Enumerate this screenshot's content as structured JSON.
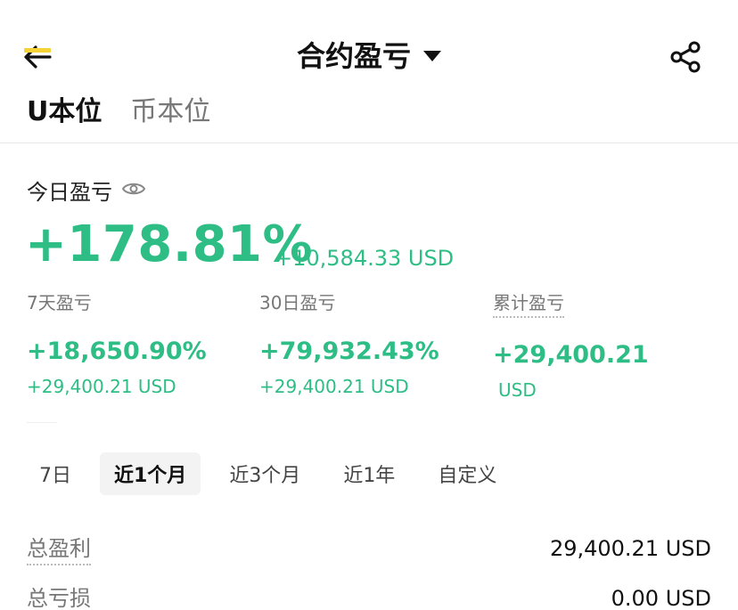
{
  "header": {
    "title": "合约盈亏",
    "back_icon": "arrow-left-icon",
    "share_icon": "share-icon"
  },
  "tabs": [
    {
      "label": "U本位",
      "active": true
    },
    {
      "label": "币本位",
      "active": false
    }
  ],
  "today": {
    "label": "今日盈亏",
    "percent": "+178.81%",
    "usd": "+10,584.33 USD"
  },
  "stats": [
    {
      "label": "7天盈亏",
      "percent": "+18,650.90%",
      "usd": "+29,400.21 USD"
    },
    {
      "label": "30日盈亏",
      "percent": "+79,932.43%",
      "usd": "+29,400.21 USD"
    },
    {
      "label": "累计盈亏",
      "percent": "+29,400.21",
      "usd": "USD"
    }
  ],
  "periods": [
    {
      "label": "7日",
      "selected": false
    },
    {
      "label": "近1个月",
      "selected": true
    },
    {
      "label": "近3个月",
      "selected": false
    },
    {
      "label": "近1年",
      "selected": false
    },
    {
      "label": "自定义",
      "selected": false
    }
  ],
  "summary": [
    {
      "label": "总盈利",
      "value": "29,400.21 USD"
    },
    {
      "label": "总亏损",
      "value": "0.00 USD"
    }
  ],
  "colors": {
    "positive": "#2ebd85",
    "accent": "#f5d235"
  }
}
